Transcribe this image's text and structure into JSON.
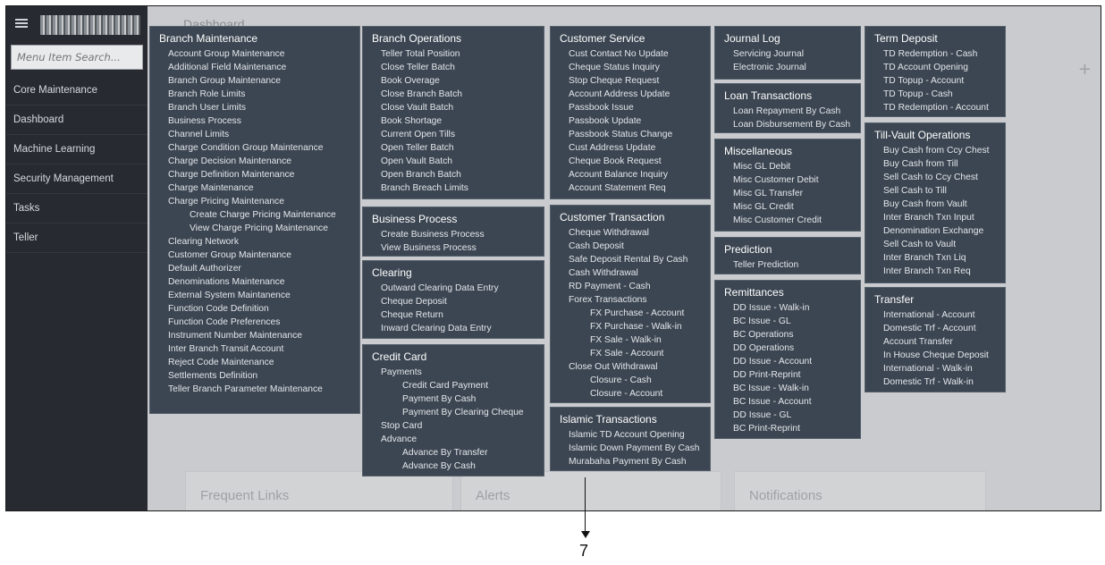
{
  "sidebar": {
    "search_placeholder": "Menu Item Search...",
    "items": [
      {
        "label": "Core Maintenance"
      },
      {
        "label": "Dashboard"
      },
      {
        "label": "Machine Learning"
      },
      {
        "label": "Security Management"
      },
      {
        "label": "Tasks"
      },
      {
        "label": "Teller"
      }
    ]
  },
  "dashboard": {
    "title": "Dashboard",
    "cards": {
      "frequent_links": "Frequent Links",
      "alerts": "Alerts",
      "notifications": "Notifications"
    }
  },
  "menu": {
    "branch_maintenance": {
      "title": "Branch Maintenance",
      "items": [
        "Account Group Maintenance",
        "Additional Field Maintenance",
        "Branch Group Maintenance",
        "Branch Role Limits",
        "Branch User Limits",
        "Business Process",
        "Channel Limits",
        "Charge Condition Group Maintenance",
        "Charge Decision Maintenance",
        "Charge Definition Maintenance",
        "Charge Maintenance",
        "Charge Pricing Maintenance"
      ],
      "sub": [
        "Create Charge Pricing Maintenance",
        "View Charge Pricing Maintenance"
      ],
      "items2": [
        "Clearing Network",
        "Customer Group Maintenance",
        "Default Authorizer",
        "Denominations Maintenance",
        "External System Maintanence",
        "Function Code Definition",
        "Function Code Preferences",
        "Instrument Number Maintenance",
        "Inter Branch Transit Account",
        "Reject Code Maintenance",
        "Settlements Definition",
        "Teller Branch Parameter Maintenance"
      ]
    },
    "branch_operations": {
      "title": "Branch Operations",
      "items": [
        "Teller Total Position",
        "Close Teller Batch",
        "Book Overage",
        "Close Branch Batch",
        "Close Vault Batch",
        "Book Shortage",
        "Current Open Tills",
        "Open Teller Batch",
        "Open Vault Batch",
        "Open Branch Batch",
        "Branch Breach Limits"
      ]
    },
    "business_process": {
      "title": "Business Process",
      "items": [
        "Create Business Process",
        "View Business Process"
      ]
    },
    "clearing": {
      "title": "Clearing",
      "items": [
        "Outward Clearing Data Entry",
        "Cheque Deposit",
        "Cheque Return",
        "Inward Clearing Data Entry"
      ]
    },
    "credit_card": {
      "title": "Credit Card",
      "payments": "Payments",
      "payments_sub": [
        "Credit Card Payment",
        "Payment By Cash",
        "Payment By Clearing Cheque"
      ],
      "stop_card": "Stop Card",
      "advance": "Advance",
      "advance_sub": [
        "Advance By Transfer",
        "Advance By Cash"
      ]
    },
    "customer_service": {
      "title": "Customer Service",
      "items": [
        "Cust Contact No Update",
        "Cheque Status Inquiry",
        "Stop Cheque Request",
        "Account Address Update",
        "Passbook Issue",
        "Passbook Update",
        "Passbook Status Change",
        "Cust Address Update",
        "Cheque Book Request",
        "Account Balance Inquiry",
        "Account Statement Req"
      ]
    },
    "customer_transaction": {
      "title": "Customer Transaction",
      "items": [
        "Cheque Withdrawal",
        "Cash Deposit",
        "Safe Deposit Rental By Cash",
        "Cash Withdrawal",
        "RD Payment - Cash",
        "Forex Transactions"
      ],
      "forex_sub": [
        "FX Purchase - Account",
        "FX Purchase - Walk-in",
        "FX Sale - Walk-in",
        "FX Sale - Account"
      ],
      "close_out": "Close Out Withdrawal",
      "close_sub": [
        "Closure - Cash",
        "Closure - Account"
      ]
    },
    "islamic_transactions": {
      "title": "Islamic Transactions",
      "items": [
        "Islamic TD Account Opening",
        "Islamic Down Payment By Cash",
        "Murabaha Payment By Cash"
      ]
    },
    "journal_log": {
      "title": "Journal Log",
      "items": [
        "Servicing Journal",
        "Electronic Journal"
      ]
    },
    "loan_transactions": {
      "title": "Loan Transactions",
      "items": [
        "Loan Repayment By Cash",
        "Loan Disbursement By Cash"
      ]
    },
    "miscellaneous": {
      "title": "Miscellaneous",
      "items": [
        "Misc GL Debit",
        "Misc Customer Debit",
        "Misc GL Transfer",
        "Misc GL Credit",
        "Misc Customer Credit"
      ]
    },
    "prediction": {
      "title": "Prediction",
      "items": [
        "Teller Prediction"
      ]
    },
    "remittances": {
      "title": "Remittances",
      "items": [
        "DD Issue - Walk-in",
        "BC Issue - GL",
        "BC Operations",
        "DD Operations",
        "DD Issue - Account",
        "DD Print-Reprint",
        "BC Issue - Walk-in",
        "BC Issue - Account",
        "DD Issue - GL",
        "BC Print-Reprint"
      ]
    },
    "term_deposit": {
      "title": "Term Deposit",
      "items": [
        "TD Redemption - Cash",
        "TD Account Opening",
        "TD Topup - Account",
        "TD Topup - Cash",
        "TD Redemption - Account"
      ]
    },
    "till_vault": {
      "title": "Till-Vault Operations",
      "items": [
        "Buy Cash from Ccy Chest",
        "Buy Cash from Till",
        "Sell Cash to Ccy Chest",
        "Sell Cash to Till",
        "Buy Cash from Vault",
        "Inter Branch Txn Input",
        "Denomination Exchange",
        "Sell Cash to Vault",
        "Inter Branch Txn Liq",
        "Inter Branch Txn Req"
      ]
    },
    "transfer": {
      "title": "Transfer",
      "items": [
        "International - Account",
        "Domestic Trf - Account",
        "Account Transfer",
        "In House Cheque Deposit",
        "International - Walk-in",
        "Domestic Trf - Walk-in"
      ]
    }
  },
  "callout": {
    "label": "7"
  }
}
